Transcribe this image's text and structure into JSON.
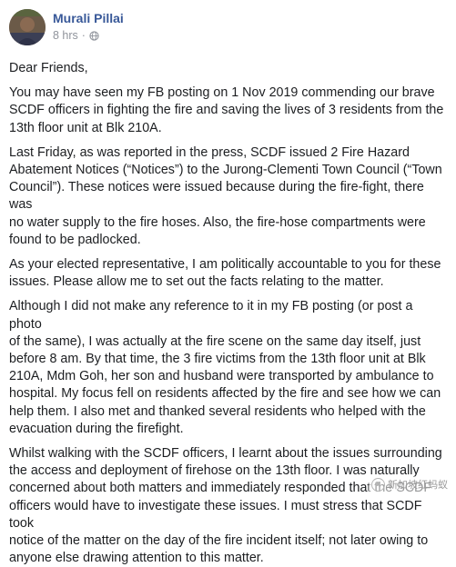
{
  "post": {
    "author": "Murali Pillai",
    "time": "8 hrs",
    "separator": "·",
    "privacy_icon": "globe-icon",
    "paragraphs": [
      "Dear Friends,",
      "You may have seen my FB posting on 1 Nov 2019 commending our brave\nSCDF officers in fighting the fire and saving the lives of 3 residents from the\n13th floor unit at Blk 210A.",
      "Last Friday, as was reported in the press, SCDF issued 2 Fire Hazard\nAbatement Notices (“Notices”) to the Jurong-Clementi Town Council (“Town\nCouncil”). These notices were issued because during the fire-fight, there was\nno water supply to the fire hoses. Also, the fire-hose compartments were\nfound to be padlocked.",
      "As your elected representative, I am politically accountable to you for these\nissues. Please allow me to set out the facts relating to the matter.",
      "Although I did not make any reference to it in my FB posting (or post a photo\nof the same), I was actually at the fire scene on the same day itself, just\nbefore 8 am. By that time, the 3 fire victims from the 13th floor unit at Blk\n210A, Mdm Goh, her son and husband were transported by ambulance to\nhospital. My focus fell on residents affected by the fire and see how we can\nhelp them. I also met and thanked several residents who helped with the\nevacuation during the firefight.",
      "Whilst walking with the SCDF officers, I learnt about the issues surrounding\nthe access and deployment of firehose on the 13th floor. I was naturally\nconcerned about both matters and immediately responded that the SCDF\nofficers would have to investigate these issues. I must stress that SCDF took\nnotice of the matter on the day of the fire incident itself; not later owing to\nanyone else drawing attention to this matter."
    ]
  },
  "watermark": {
    "text": "新加坡红蚂蚁",
    "icon": "ant-logo-icon"
  },
  "colors": {
    "author": "#385898",
    "meta": "#90949c",
    "text": "#1c1e21"
  }
}
